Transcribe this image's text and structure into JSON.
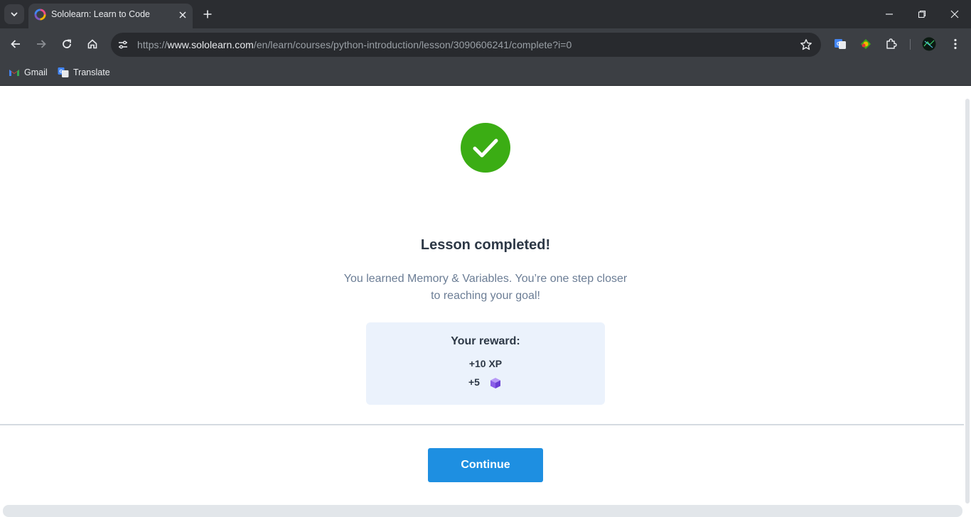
{
  "browser": {
    "tab": {
      "title": "Sololearn: Learn to Code"
    },
    "url": {
      "scheme": "https://",
      "host": "www.sololearn.com",
      "path": "/en/learn/courses/python-introduction/lesson/3090606241/complete?i=0"
    },
    "bookmarks": [
      {
        "label": "Gmail",
        "icon": "gmail-icon"
      },
      {
        "label": "Translate",
        "icon": "translate-icon"
      }
    ]
  },
  "lesson": {
    "title": "Lesson completed!",
    "message": "You learned Memory & Variables. You’re one step closer to reaching your goal!",
    "reward": {
      "heading": "Your reward:",
      "xp": "+10 XP",
      "bits": "+5",
      "bits_icon": "purple-cube-icon"
    },
    "continue_label": "Continue"
  },
  "colors": {
    "success": "#3bad14",
    "primary_button": "#1e8fe1",
    "reward_background": "#ebf2fc",
    "bit_icon": "#9b6cf0"
  }
}
